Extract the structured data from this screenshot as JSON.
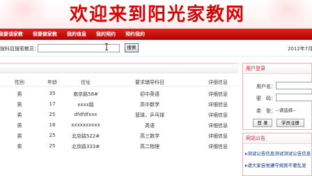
{
  "banner": {
    "title": "欢迎来到阳光家教网"
  },
  "nav": {
    "items": [
      "我要请家教",
      "我要做家教",
      "我的信息",
      "我的预约",
      "预约我的"
    ]
  },
  "search": {
    "label": "按科目搜索教员：",
    "input_value": "",
    "button_label": "搜索"
  },
  "date": {
    "text": "2012年7月"
  },
  "table": {
    "headers": [
      "性别",
      "年龄",
      "住址",
      "要求辅导科目",
      "详细信息"
    ],
    "rows": [
      [
        "男",
        "35",
        "南京路58#",
        "初中英语",
        "详细信息"
      ],
      [
        "男",
        "17",
        "xxxx路",
        "高中数学",
        "详细信息"
      ],
      [
        "男",
        "25",
        "dfdfdfxxx",
        "篮球，乒乓球",
        "详细信息"
      ],
      [
        "男",
        "18",
        "xxxxxxxxxx",
        "英语",
        "详细信息"
      ],
      [
        "男",
        "25",
        "北京路522#",
        "高三数学",
        "详细信息"
      ],
      [
        "男",
        "25",
        "北京路333#",
        "高二物理",
        "详细信息"
      ]
    ]
  },
  "login": {
    "title": "用户登录",
    "username_label": "用户名：",
    "password_label": "密　码：",
    "type_label": "类　型：",
    "type_selected": "--请选择--",
    "login_button": "登 录",
    "register_button": "学员注册"
  },
  "notice": {
    "title": "网站公告",
    "items": [
      "测试公告信息测试测试公告信息",
      "请大家自觉遵守规则不要乱发"
    ]
  },
  "colors": {
    "brand_red": "#d80000",
    "nav_red": "#c40000",
    "link_blue": "#00338a"
  }
}
